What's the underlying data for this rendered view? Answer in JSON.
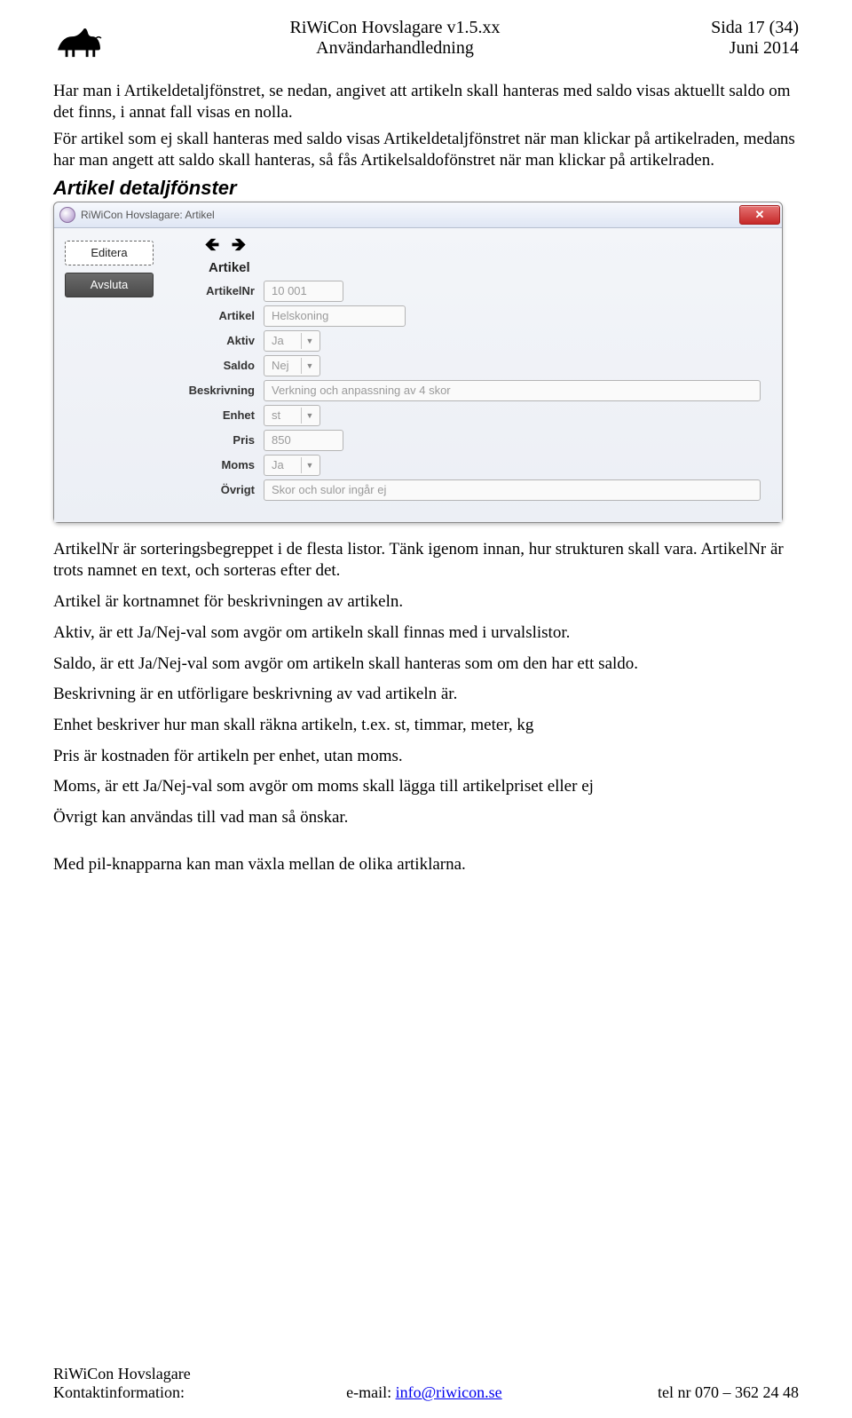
{
  "header": {
    "title_line1": "RiWiCon Hovslagare v1.5.xx",
    "title_line2": "Användarhandledning",
    "page_label": "Sida 17 (34)",
    "date": "Juni 2014"
  },
  "intro": {
    "p1": "Har man i Artikeldetaljfönstret, se nedan, angivet att artikeln skall hanteras med saldo visas aktuellt saldo om det finns, i annat fall visas en nolla.",
    "p2": "För artikel som ej skall hanteras med saldo visas Artikeldetaljfönstret när man klickar på artikelraden, medans har man angett att saldo skall hanteras, så fås Artikelsaldofönstret när man klickar på artikelraden."
  },
  "section_title": "Artikel detaljfönster",
  "window": {
    "title": "RiWiCon Hovslagare: Artikel",
    "buttons": {
      "editera": "Editera",
      "avsluta": "Avsluta"
    },
    "form_title": "Artikel",
    "fields": {
      "artikelnr": {
        "label": "ArtikelNr",
        "value": "10 001"
      },
      "artikel": {
        "label": "Artikel",
        "value": "Helskoning"
      },
      "aktiv": {
        "label": "Aktiv",
        "value": "Ja"
      },
      "saldo": {
        "label": "Saldo",
        "value": "Nej"
      },
      "beskrivning": {
        "label": "Beskrivning",
        "value": "Verkning och anpassning av 4 skor"
      },
      "enhet": {
        "label": "Enhet",
        "value": "st"
      },
      "pris": {
        "label": "Pris",
        "value": "850"
      },
      "moms": {
        "label": "Moms",
        "value": "Ja"
      },
      "ovrigt": {
        "label": "Övrigt",
        "value": "Skor och sulor ingår ej"
      }
    }
  },
  "body": {
    "p1": "ArtikelNr är sorteringsbegreppet i de flesta listor. Tänk igenom innan, hur strukturen skall vara. ArtikelNr är trots namnet en text, och sorteras efter det.",
    "p2": "Artikel är kortnamnet för beskrivningen av artikeln.",
    "p3": "Aktiv, är ett Ja/Nej-val som avgör om artikeln skall finnas med i urvalslistor.",
    "p4": "Saldo, är ett Ja/Nej-val som avgör om artikeln skall hanteras som om den har ett saldo.",
    "p5": "Beskrivning är en utförligare beskrivning av vad artikeln är.",
    "p6": "Enhet beskriver hur man skall räkna artikeln, t.ex. st, timmar, meter, kg",
    "p7": "Pris är kostnaden för artikeln per enhet, utan moms.",
    "p8": "Moms, är ett Ja/Nej-val som avgör om moms skall lägga till artikelpriset eller ej",
    "p9": "Övrigt kan användas till vad man så önskar.",
    "p10": "Med pil-knapparna kan man växla mellan de olika artiklarna."
  },
  "footer": {
    "left1": "RiWiCon Hovslagare",
    "left2": "Kontaktinformation:",
    "email_label": "e-mail: ",
    "email": "info@riwicon.se",
    "phone": "tel nr 070 – 362 24 48"
  }
}
